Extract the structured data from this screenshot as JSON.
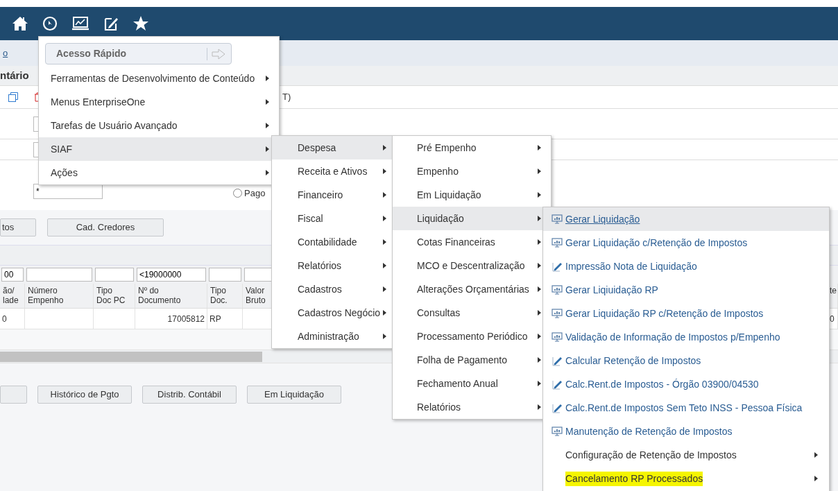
{
  "page": {
    "breadcrumb_link": "o",
    "form_title": "ntário",
    "toolbar_text": "T)",
    "filter_value": "*",
    "radio": {
      "label": "Pago",
      "selected": false
    },
    "buttons": [
      "tos",
      "Cad. Credores"
    ]
  },
  "table": {
    "filters": [
      {
        "kind": "text",
        "value": "00"
      },
      {
        "kind": "blank"
      },
      {
        "kind": "blank"
      },
      {
        "kind": "text",
        "value": "<19000000"
      },
      {
        "kind": "blank"
      },
      {
        "kind": "blank"
      }
    ],
    "columns": [
      "ão/\nlade",
      "Número\nEmpenho",
      "Tipo\nDoc PC",
      "Nº do\nDocumento",
      "Tipo\nDoc.",
      "Valor\nBruto",
      "te"
    ],
    "rows": [
      [
        "0",
        "",
        "",
        "17005812",
        "RP",
        "",
        "0"
      ]
    ]
  },
  "bottom_buttons": [
    {
      "kind": "blank"
    },
    {
      "kind": "text",
      "label": "Histórico de Pgto"
    },
    {
      "kind": "text",
      "label": "Distrib. Contábil"
    },
    {
      "kind": "text",
      "label": "Em Liquidação"
    }
  ],
  "quick_access": {
    "placeholder": "Acesso Rápido"
  },
  "menu": [
    {
      "label": "Ferramentas de Desenvolvimento de Conteúdo",
      "selected": false
    },
    {
      "label": "Menus EnterpriseOne",
      "selected": false
    },
    {
      "label": "Tarefas de Usuário Avançado",
      "selected": false
    },
    {
      "label": "SIAF",
      "selected": true
    },
    {
      "label": "Ações",
      "selected": false
    }
  ],
  "submenu_siaf": [
    {
      "label": "Despesa",
      "selected": true
    },
    {
      "label": "Receita e Ativos",
      "selected": false
    },
    {
      "label": "Financeiro",
      "selected": false
    },
    {
      "label": "Fiscal",
      "selected": false
    },
    {
      "label": "Contabilidade",
      "selected": false
    },
    {
      "label": "Relatórios",
      "selected": false
    },
    {
      "label": "Cadastros",
      "selected": false
    },
    {
      "label": "Cadastros Negócio",
      "selected": false
    },
    {
      "label": "Administração",
      "selected": false
    }
  ],
  "submenu_despesa": [
    {
      "label": "Pré Empenho",
      "selected": false
    },
    {
      "label": "Empenho",
      "selected": false
    },
    {
      "label": "Em Liquidação",
      "selected": false
    },
    {
      "label": "Liquidação",
      "selected": true
    },
    {
      "label": "Cotas Financeiras",
      "selected": false
    },
    {
      "label": "MCO e Descentralização",
      "selected": false
    },
    {
      "label": "Alterações Orçamentárias",
      "selected": false
    },
    {
      "label": "Consultas",
      "selected": false
    },
    {
      "label": "Processamento Periódico",
      "selected": false
    },
    {
      "label": "Folha de Pagamento",
      "selected": false
    },
    {
      "label": "Fechamento Anual",
      "selected": false
    },
    {
      "label": "Relatórios",
      "selected": false
    }
  ],
  "submenu_liquidacao": [
    {
      "kind": "report",
      "label": "Gerar Liquidação",
      "selected": true,
      "highlighted": false
    },
    {
      "kind": "report",
      "label": "Gerar Liquidação c/Retenção de Impostos",
      "selected": false,
      "highlighted": false
    },
    {
      "kind": "edit",
      "label": "Impressão Nota de Liquidação",
      "selected": false,
      "highlighted": false
    },
    {
      "kind": "report",
      "label": "Gerar Liqiuidação RP",
      "selected": false,
      "highlighted": false
    },
    {
      "kind": "report",
      "label": "Gerar Liquidação RP c/Retenção de Impostos",
      "selected": false,
      "highlighted": false
    },
    {
      "kind": "report",
      "label": "Validação de Informação de Impostos p/Empenho",
      "selected": false,
      "highlighted": false
    },
    {
      "kind": "edit",
      "label": "Calcular Retenção de Impostos",
      "selected": false,
      "highlighted": false
    },
    {
      "kind": "edit",
      "label": "Calc.Rent.de Impostos - Órgão 03900/04530",
      "selected": false,
      "highlighted": false
    },
    {
      "kind": "edit",
      "label": "Calc.Rent.de Impostos Sem Teto INSS - Pessoa Física",
      "selected": false,
      "highlighted": false
    },
    {
      "kind": "report",
      "label": "Manutenção de Retenção de Impostos",
      "selected": false,
      "highlighted": false
    },
    {
      "kind": "folder",
      "label": "Configuração de Retenção de Impostos",
      "selected": false,
      "highlighted": false
    },
    {
      "kind": "folder",
      "label": "Cancelamento RP Processados",
      "selected": false,
      "highlighted": true
    }
  ]
}
